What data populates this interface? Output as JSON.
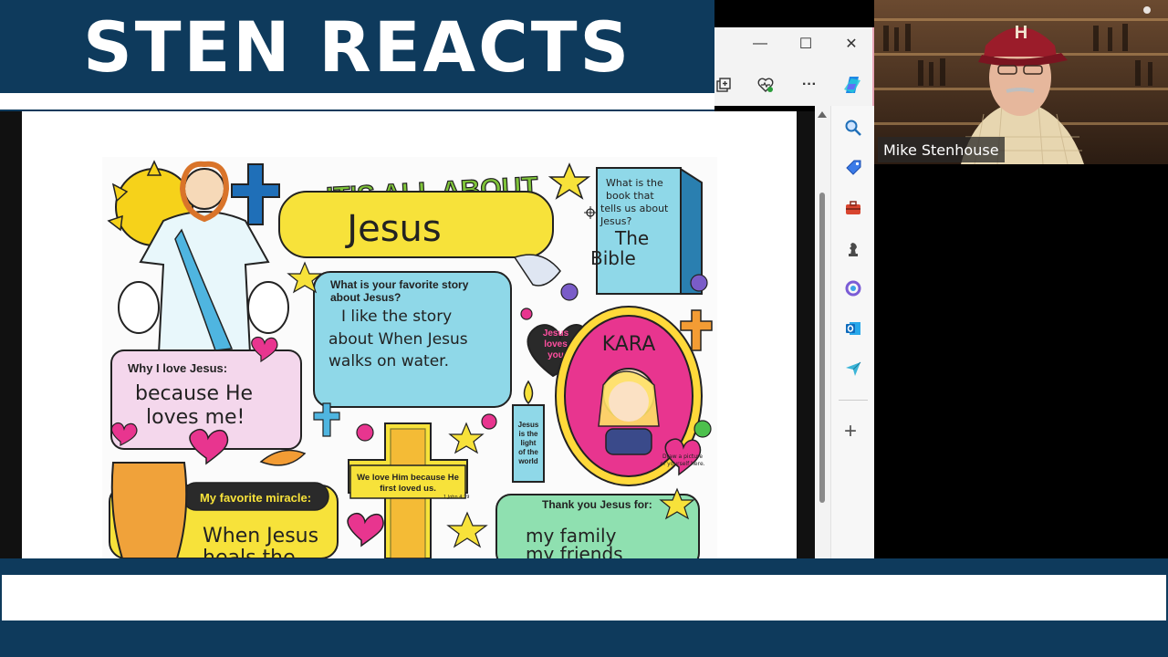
{
  "banner": {
    "title": "STEN REACTS"
  },
  "webcam": {
    "name": "Mike Stenhouse",
    "cap_letter": "H"
  },
  "window": {
    "minimize_glyph": "—",
    "maximize_glyph": "☐",
    "close_glyph": "✕"
  },
  "toolbar": {
    "more_glyph": "···"
  },
  "sidebar": {
    "add_glyph": "+",
    "icons": [
      "search-icon",
      "tag-icon",
      "toolbox-icon",
      "chess-icon",
      "copilot-icon",
      "outlook-icon",
      "send-icon"
    ]
  },
  "poster": {
    "title_top": "IT'S ALL ABOUT",
    "title_main": "Jesus",
    "bible_question": [
      "What is the",
      "book that",
      "tells us about",
      "Jesus?"
    ],
    "bible_answer": [
      "The",
      "Bible"
    ],
    "story_question": [
      "What is your favorite story",
      "about Jesus?"
    ],
    "story_answer": [
      "I like the story",
      "about When Jesus",
      "walks on water."
    ],
    "heart_label": [
      "Jesus",
      "loves",
      "you"
    ],
    "name": "KARA",
    "why_question": "Why I love Jesus:",
    "why_answer": [
      "because He",
      "loves me!"
    ],
    "candle_text": [
      "Jesus",
      "is the",
      "light",
      "of the",
      "world"
    ],
    "draw_note": [
      "Draw a picture",
      "of yourself here."
    ],
    "cross_text": [
      "We love Him because He",
      "first loved us."
    ],
    "verse_ref": "1 John 4:19",
    "miracle_label": "My favorite miracle:",
    "miracle_answer": [
      "When Jesus",
      "heals the"
    ],
    "thanks_label": "Thank you Jesus for:",
    "thanks_answer": [
      "my family",
      "my friends"
    ]
  },
  "colors": {
    "brand_navy": "#0e3a5c",
    "poster_yellow": "#f7e23a",
    "poster_cyan": "#8fd8e8",
    "poster_pink": "#e8358f",
    "poster_green": "#8fe0b0"
  }
}
